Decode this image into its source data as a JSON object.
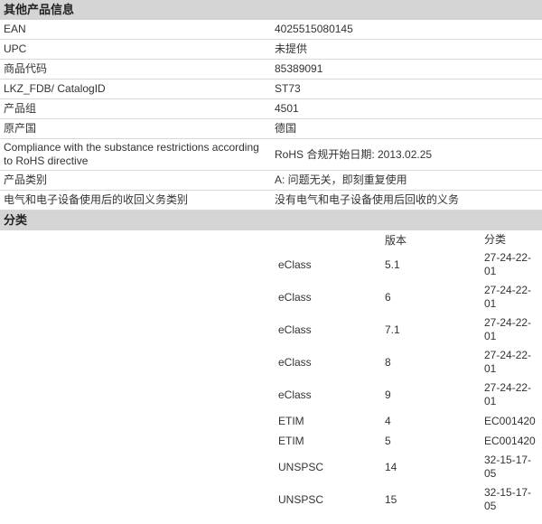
{
  "product_info": {
    "title": "其他产品信息",
    "rows": [
      {
        "label": "EAN",
        "value": "4025515080145"
      },
      {
        "label": "UPC",
        "value": "未提供"
      },
      {
        "label": "商品代码",
        "value": "85389091"
      },
      {
        "label": "LKZ_FDB/ CatalogID",
        "value": "ST73"
      },
      {
        "label": "产品组",
        "value": "4501"
      },
      {
        "label": "原产国",
        "value": "德国"
      },
      {
        "label": "Compliance with the substance restrictions according to RoHS directive",
        "value": "RoHS 合规开始日期: 2013.02.25"
      },
      {
        "label": "产品类别",
        "value": "A: 问题无关，即刻重复使用"
      },
      {
        "label": "电气和电子设备使用后的收回义务类别",
        "value": "没有电气和电子设备使用后回收的义务"
      }
    ]
  },
  "classification": {
    "title": "分类",
    "header_version": "版本",
    "header_class": "分类",
    "rows": [
      {
        "system": "eClass",
        "version": "5.1",
        "code": "27-24-22-01"
      },
      {
        "system": "eClass",
        "version": "6",
        "code": "27-24-22-01"
      },
      {
        "system": "eClass",
        "version": "7.1",
        "code": "27-24-22-01"
      },
      {
        "system": "eClass",
        "version": "8",
        "code": "27-24-22-01"
      },
      {
        "system": "eClass",
        "version": "9",
        "code": "27-24-22-01"
      },
      {
        "system": "ETIM",
        "version": "4",
        "code": "EC001420"
      },
      {
        "system": "ETIM",
        "version": "5",
        "code": "EC001420"
      },
      {
        "system": "UNSPSC",
        "version": "14",
        "code": "32-15-17-05"
      },
      {
        "system": "UNSPSC",
        "version": "15",
        "code": "32-15-17-05"
      }
    ]
  }
}
